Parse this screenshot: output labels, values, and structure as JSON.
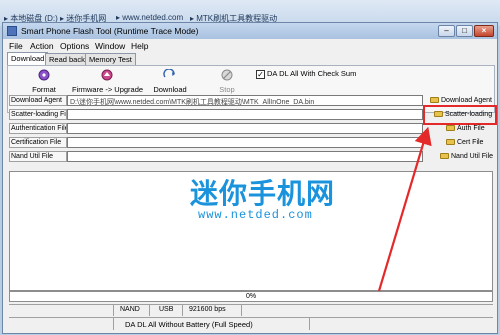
{
  "explorer": {
    "crumbs": [
      "▸ 本地磁盘 (D:)",
      "▸ 迷你手机网",
      "▸ www.netded.com",
      "▸ MTK刷机工具教程驱动"
    ]
  },
  "window": {
    "title": "Smart Phone Flash Tool (Runtime Trace Mode)",
    "buttons": {
      "minimize": "–",
      "maximize": "□",
      "close": "×"
    }
  },
  "menu": [
    "File",
    "Action",
    "Options",
    "Window",
    "Help"
  ],
  "tabs": [
    "Download",
    "Read back",
    "Memory Test"
  ],
  "toolbar": {
    "format": "Format",
    "upgrade": "Firmware -> Upgrade",
    "download": "Download",
    "stop": "Stop",
    "check_label": "DA DL All With Check Sum",
    "check_mark": "✓"
  },
  "files": [
    {
      "label": "Download Agent",
      "value": "D:\\迷你手机网\\www.netded.com\\MTK刷机工具教程驱动\\MTK_AllInOne_DA.bin",
      "button": "Download Agent"
    },
    {
      "label": "Scatter-loading File",
      "value": "",
      "button": "Scatter-loading"
    },
    {
      "label": "Authentication File",
      "value": "",
      "button": "Auth File"
    },
    {
      "label": "Certification File",
      "value": "",
      "button": "Cert File"
    },
    {
      "label": "Nand Util File",
      "value": "",
      "button": "Nand Util File"
    }
  ],
  "watermark": {
    "title": "迷你手机网",
    "url": "www.netded.com"
  },
  "progress": {
    "text": "0%",
    "percent": 0
  },
  "status": {
    "storage": "NAND",
    "port": "USB",
    "baud": "921600 bps",
    "mode": "DA DL All Without Battery (Full Speed)"
  },
  "colors": {
    "highlight": "#e4292a",
    "watermark": "#1a93dc"
  },
  "icons": [
    "format-icon",
    "upgrade-icon",
    "download-icon",
    "stop-icon",
    "folder-icon"
  ]
}
